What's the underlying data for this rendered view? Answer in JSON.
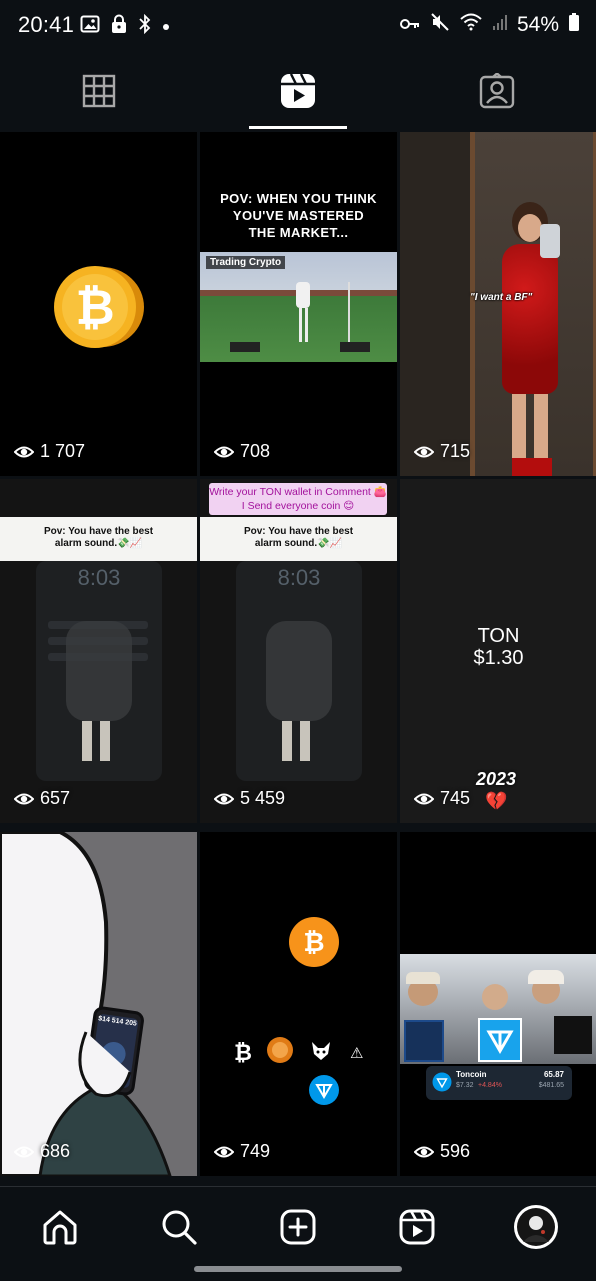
{
  "status_bar": {
    "time": "20:41",
    "battery": "54%",
    "left_icons": [
      "image-icon",
      "lock-icon",
      "bluetooth-icon",
      "dot-icon"
    ],
    "right_icons": [
      "key-icon",
      "mute-icon",
      "wifi-icon",
      "signal-icon",
      "battery-icon"
    ]
  },
  "tabs": [
    {
      "name": "posts",
      "icon": "grid-icon",
      "active": false
    },
    {
      "name": "reels",
      "icon": "reels-icon",
      "active": true
    },
    {
      "name": "tagged",
      "icon": "tagged-icon",
      "active": false
    }
  ],
  "grid": [
    {
      "views": "1 707",
      "type": "bitcoin-coin"
    },
    {
      "views": "708",
      "headline": "POV: WHEN YOU THINK\nYOU'VE MASTERED\nTHE MARKET...",
      "label": "Trading Crypto"
    },
    {
      "views": "715",
      "caption": "\"I want a BF\""
    },
    {
      "views": "657",
      "banner": "Pov: You have the best\nalarm sound.💸📈",
      "clock": "8:03"
    },
    {
      "views": "5 459",
      "top_caption": "Write your TON wallet in Comment 👛\nI Send everyone coin 😊",
      "banner": "Pov: You have the best\nalarm sound.💸📈",
      "clock": "8:03"
    },
    {
      "views": "745",
      "title": "TON\n$1.30",
      "year": "2023",
      "emoji": "💔"
    },
    {
      "views": "686",
      "phone_balance": "$14 514 205"
    },
    {
      "views": "749",
      "type": "crypto-icons"
    },
    {
      "views": "596",
      "ton_name": "Toncoin",
      "ton_price": "$7.32",
      "ton_change": "+4.84%",
      "ton_amount": "65.87",
      "ton_value": "$481.65"
    }
  ],
  "bottom_nav": [
    {
      "name": "home",
      "icon": "home-icon"
    },
    {
      "name": "search",
      "icon": "search-icon"
    },
    {
      "name": "create",
      "icon": "plus-square-icon"
    },
    {
      "name": "reels",
      "icon": "reels-icon"
    },
    {
      "name": "profile",
      "icon": "avatar"
    }
  ],
  "colors": {
    "background": "#0c1014",
    "bitcoin_orange": "#f7931a",
    "ton_blue": "#0098ea"
  }
}
